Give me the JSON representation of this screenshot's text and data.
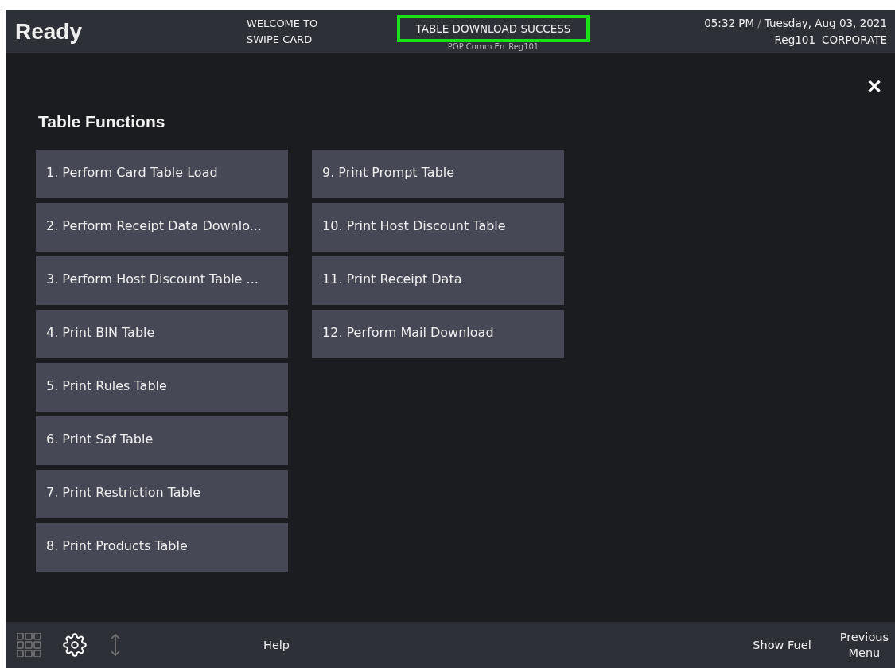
{
  "header": {
    "status": "Ready",
    "prompt": [
      "WELCOME TO",
      "SWIPE CARD"
    ],
    "message": "TABLE DOWNLOAD SUCCESS",
    "message_highlighted": true,
    "sub_message": "POP Comm Err Reg101",
    "time": "05:32 PM",
    "separator": "/",
    "date": "Tuesday, Aug 03, 2021",
    "register": "Reg101",
    "store": "CORPORATE"
  },
  "close_button": "✕",
  "panel": {
    "title": "Table Functions",
    "columns": [
      [
        {
          "label": "1. Perform Card Table Load"
        },
        {
          "label": "2. Perform Receipt Data Downlo..."
        },
        {
          "label": "3. Perform Host Discount Table ..."
        },
        {
          "label": "4. Print BIN Table"
        },
        {
          "label": "5. Print Rules Table"
        },
        {
          "label": "6. Print Saf Table"
        },
        {
          "label": "7. Print Restriction Table"
        },
        {
          "label": "8. Print Products Table"
        }
      ],
      [
        {
          "label": "9. Print Prompt Table"
        },
        {
          "label": "10. Print Host Discount Table"
        },
        {
          "label": "11. Print Receipt Data"
        },
        {
          "label": "12. Perform Mail Download"
        }
      ]
    ]
  },
  "footer": {
    "icons": [
      {
        "kind": "grid",
        "disabled": true
      },
      {
        "kind": "gear",
        "disabled": false
      },
      {
        "kind": "updown",
        "disabled": true
      }
    ],
    "help": "Help",
    "show_fuel": "Show Fuel",
    "previous_menu": [
      "Previous",
      "Menu"
    ]
  }
}
